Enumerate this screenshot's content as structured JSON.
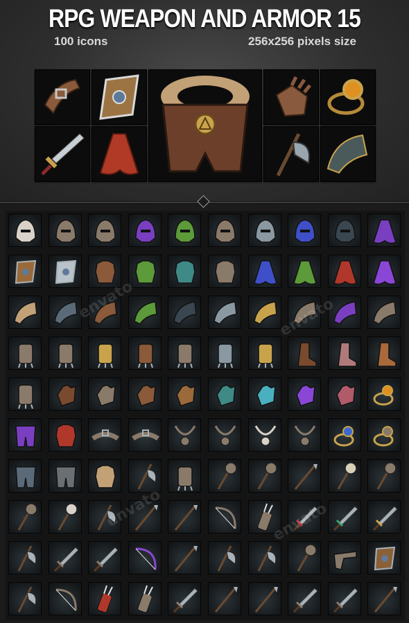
{
  "title": "RPG WEAPON AND ARMOR 15",
  "subtitle_left": "100 icons",
  "subtitle_right": "256x256  pixels size",
  "watermark": "envato",
  "showcase_icons": [
    "belt-icon",
    "shield-icon",
    "fur-armor-icon",
    "gauntlet-icon",
    "amber-ring-icon",
    "dagger-icon",
    "red-cape-icon",
    "battle-axe-icon",
    "pauldron-icon"
  ],
  "icon_rows": [
    [
      "skull-helmet",
      "goggle-helmet",
      "winged-helm",
      "purple-hood",
      "green-helm",
      "horned-helm",
      "steel-helm",
      "blue-hood",
      "dark-helm",
      "purple-cloak"
    ],
    [
      "bronze-shield",
      "silver-shield",
      "leather-vest",
      "green-vest",
      "teal-armor",
      "plate-armor",
      "blue-cloak",
      "green-cloak",
      "red-cloak",
      "violet-cloak"
    ],
    [
      "fur-pauldron",
      "slate-pauldron",
      "leather-pauldron",
      "green-pauldron",
      "dark-pauldron",
      "steel-pauldron",
      "gold-pauldron",
      "jagged-pauldron",
      "purple-pauldron",
      "scale-pauldron"
    ],
    [
      "claw-bracer",
      "clawed-bracer",
      "gold-bracer",
      "leather-bracer",
      "spiked-bracer",
      "steel-greaves",
      "gold-greaves",
      "brown-boots",
      "pink-boots",
      "copper-boots"
    ],
    [
      "eye-claw",
      "brown-glove",
      "studded-glove",
      "leather-glove",
      "bronze-glove",
      "teal-glove",
      "cyan-glove",
      "violet-glove",
      "rose-glove",
      "amber-ring"
    ],
    [
      "purple-pants",
      "red-tunic",
      "strap-belt",
      "hip-belt",
      "amulet",
      "star-necklace",
      "skull-necklace",
      "fang-necklace",
      "sapphire-ring",
      "gem-ring"
    ],
    [
      "slate-pants",
      "grey-pants",
      "fur-armor",
      "pick-axe",
      "claw-hammer",
      "war-hammer",
      "morning-star",
      "rune-staff",
      "bone-club",
      "spike-mace"
    ],
    [
      "spiked-club",
      "skull-club",
      "halberd",
      "ice-spear",
      "silver-spear",
      "crossbow",
      "quiver",
      "ruby-dagger",
      "emerald-sword",
      "gold-sword"
    ],
    [
      "hand-axe",
      "knife",
      "short-sword",
      "violet-bow",
      "sickle",
      "wood-axe",
      "bearded-axe",
      "mallet",
      "pistol",
      "wood-shield"
    ],
    [
      "double-axe",
      "heavy-crossbow",
      "red-quiver",
      "arrows",
      "broad-sword",
      "spear",
      "lance",
      "long-sword",
      "wavy-sword",
      "hook-staff"
    ]
  ]
}
